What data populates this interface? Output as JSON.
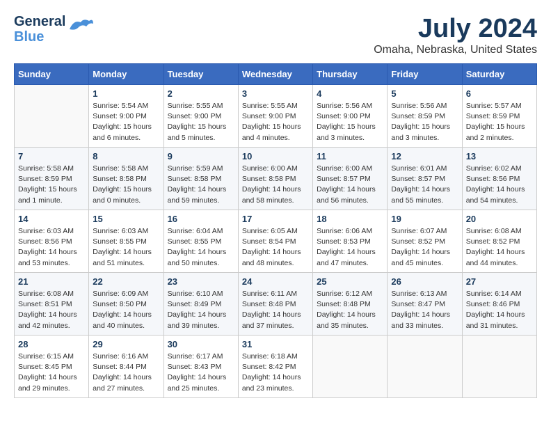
{
  "header": {
    "logo_general": "General",
    "logo_blue": "Blue",
    "month_title": "July 2024",
    "location": "Omaha, Nebraska, United States"
  },
  "weekdays": [
    "Sunday",
    "Monday",
    "Tuesday",
    "Wednesday",
    "Thursday",
    "Friday",
    "Saturday"
  ],
  "weeks": [
    [
      {
        "day": "",
        "info": ""
      },
      {
        "day": "1",
        "info": "Sunrise: 5:54 AM\nSunset: 9:00 PM\nDaylight: 15 hours\nand 6 minutes."
      },
      {
        "day": "2",
        "info": "Sunrise: 5:55 AM\nSunset: 9:00 PM\nDaylight: 15 hours\nand 5 minutes."
      },
      {
        "day": "3",
        "info": "Sunrise: 5:55 AM\nSunset: 9:00 PM\nDaylight: 15 hours\nand 4 minutes."
      },
      {
        "day": "4",
        "info": "Sunrise: 5:56 AM\nSunset: 9:00 PM\nDaylight: 15 hours\nand 3 minutes."
      },
      {
        "day": "5",
        "info": "Sunrise: 5:56 AM\nSunset: 8:59 PM\nDaylight: 15 hours\nand 3 minutes."
      },
      {
        "day": "6",
        "info": "Sunrise: 5:57 AM\nSunset: 8:59 PM\nDaylight: 15 hours\nand 2 minutes."
      }
    ],
    [
      {
        "day": "7",
        "info": "Sunrise: 5:58 AM\nSunset: 8:59 PM\nDaylight: 15 hours\nand 1 minute."
      },
      {
        "day": "8",
        "info": "Sunrise: 5:58 AM\nSunset: 8:58 PM\nDaylight: 15 hours\nand 0 minutes."
      },
      {
        "day": "9",
        "info": "Sunrise: 5:59 AM\nSunset: 8:58 PM\nDaylight: 14 hours\nand 59 minutes."
      },
      {
        "day": "10",
        "info": "Sunrise: 6:00 AM\nSunset: 8:58 PM\nDaylight: 14 hours\nand 58 minutes."
      },
      {
        "day": "11",
        "info": "Sunrise: 6:00 AM\nSunset: 8:57 PM\nDaylight: 14 hours\nand 56 minutes."
      },
      {
        "day": "12",
        "info": "Sunrise: 6:01 AM\nSunset: 8:57 PM\nDaylight: 14 hours\nand 55 minutes."
      },
      {
        "day": "13",
        "info": "Sunrise: 6:02 AM\nSunset: 8:56 PM\nDaylight: 14 hours\nand 54 minutes."
      }
    ],
    [
      {
        "day": "14",
        "info": "Sunrise: 6:03 AM\nSunset: 8:56 PM\nDaylight: 14 hours\nand 53 minutes."
      },
      {
        "day": "15",
        "info": "Sunrise: 6:03 AM\nSunset: 8:55 PM\nDaylight: 14 hours\nand 51 minutes."
      },
      {
        "day": "16",
        "info": "Sunrise: 6:04 AM\nSunset: 8:55 PM\nDaylight: 14 hours\nand 50 minutes."
      },
      {
        "day": "17",
        "info": "Sunrise: 6:05 AM\nSunset: 8:54 PM\nDaylight: 14 hours\nand 48 minutes."
      },
      {
        "day": "18",
        "info": "Sunrise: 6:06 AM\nSunset: 8:53 PM\nDaylight: 14 hours\nand 47 minutes."
      },
      {
        "day": "19",
        "info": "Sunrise: 6:07 AM\nSunset: 8:52 PM\nDaylight: 14 hours\nand 45 minutes."
      },
      {
        "day": "20",
        "info": "Sunrise: 6:08 AM\nSunset: 8:52 PM\nDaylight: 14 hours\nand 44 minutes."
      }
    ],
    [
      {
        "day": "21",
        "info": "Sunrise: 6:08 AM\nSunset: 8:51 PM\nDaylight: 14 hours\nand 42 minutes."
      },
      {
        "day": "22",
        "info": "Sunrise: 6:09 AM\nSunset: 8:50 PM\nDaylight: 14 hours\nand 40 minutes."
      },
      {
        "day": "23",
        "info": "Sunrise: 6:10 AM\nSunset: 8:49 PM\nDaylight: 14 hours\nand 39 minutes."
      },
      {
        "day": "24",
        "info": "Sunrise: 6:11 AM\nSunset: 8:48 PM\nDaylight: 14 hours\nand 37 minutes."
      },
      {
        "day": "25",
        "info": "Sunrise: 6:12 AM\nSunset: 8:48 PM\nDaylight: 14 hours\nand 35 minutes."
      },
      {
        "day": "26",
        "info": "Sunrise: 6:13 AM\nSunset: 8:47 PM\nDaylight: 14 hours\nand 33 minutes."
      },
      {
        "day": "27",
        "info": "Sunrise: 6:14 AM\nSunset: 8:46 PM\nDaylight: 14 hours\nand 31 minutes."
      }
    ],
    [
      {
        "day": "28",
        "info": "Sunrise: 6:15 AM\nSunset: 8:45 PM\nDaylight: 14 hours\nand 29 minutes."
      },
      {
        "day": "29",
        "info": "Sunrise: 6:16 AM\nSunset: 8:44 PM\nDaylight: 14 hours\nand 27 minutes."
      },
      {
        "day": "30",
        "info": "Sunrise: 6:17 AM\nSunset: 8:43 PM\nDaylight: 14 hours\nand 25 minutes."
      },
      {
        "day": "31",
        "info": "Sunrise: 6:18 AM\nSunset: 8:42 PM\nDaylight: 14 hours\nand 23 minutes."
      },
      {
        "day": "",
        "info": ""
      },
      {
        "day": "",
        "info": ""
      },
      {
        "day": "",
        "info": ""
      }
    ]
  ]
}
